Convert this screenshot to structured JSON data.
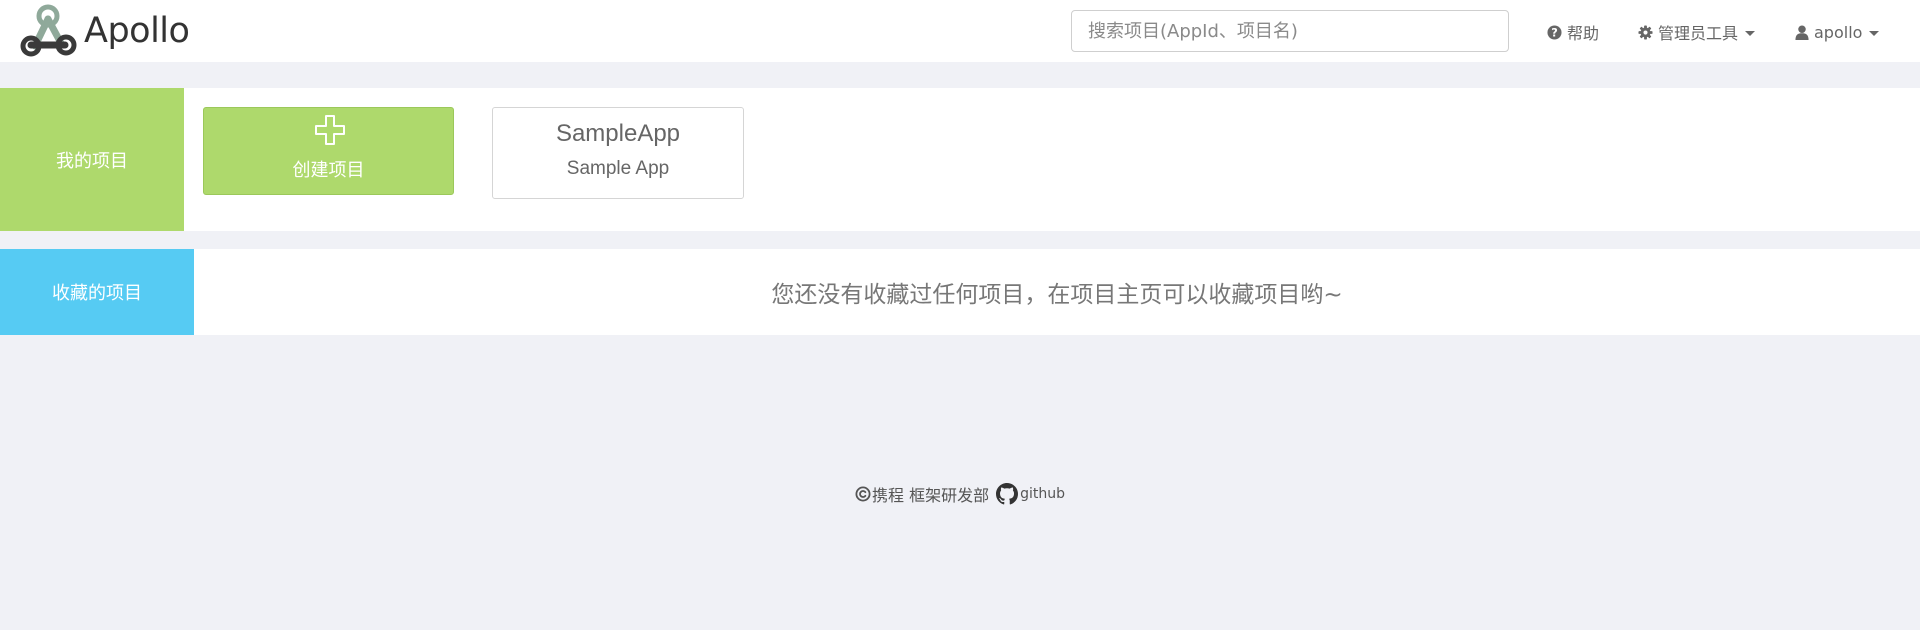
{
  "brand": {
    "name": "Apollo",
    "logo_icon": "apollo-webhook-logo"
  },
  "header": {
    "search": {
      "placeholder": "搜索项目(AppId、项目名)",
      "value": ""
    },
    "help": {
      "label": "帮助",
      "icon": "question-circle-icon"
    },
    "admin_tools": {
      "label": "管理员工具",
      "icon": "gear-icon"
    },
    "user": {
      "label": "apollo",
      "icon": "user-icon"
    }
  },
  "my_projects": {
    "title": "我的项目",
    "create_label": "创建项目",
    "apps": [
      {
        "app_id": "SampleApp",
        "name": "Sample App"
      }
    ]
  },
  "favorites": {
    "title": "收藏的项目",
    "empty_message": "您还没有收藏过任何项目，在项目主页可以收藏项目哟~"
  },
  "footer": {
    "company": "携程 框架研发部",
    "github_label": "github"
  },
  "colors": {
    "background": "#f0f1f6",
    "my_projects_accent": "#aed96c",
    "favorites_accent": "#56cbf3",
    "text": "#555555"
  }
}
